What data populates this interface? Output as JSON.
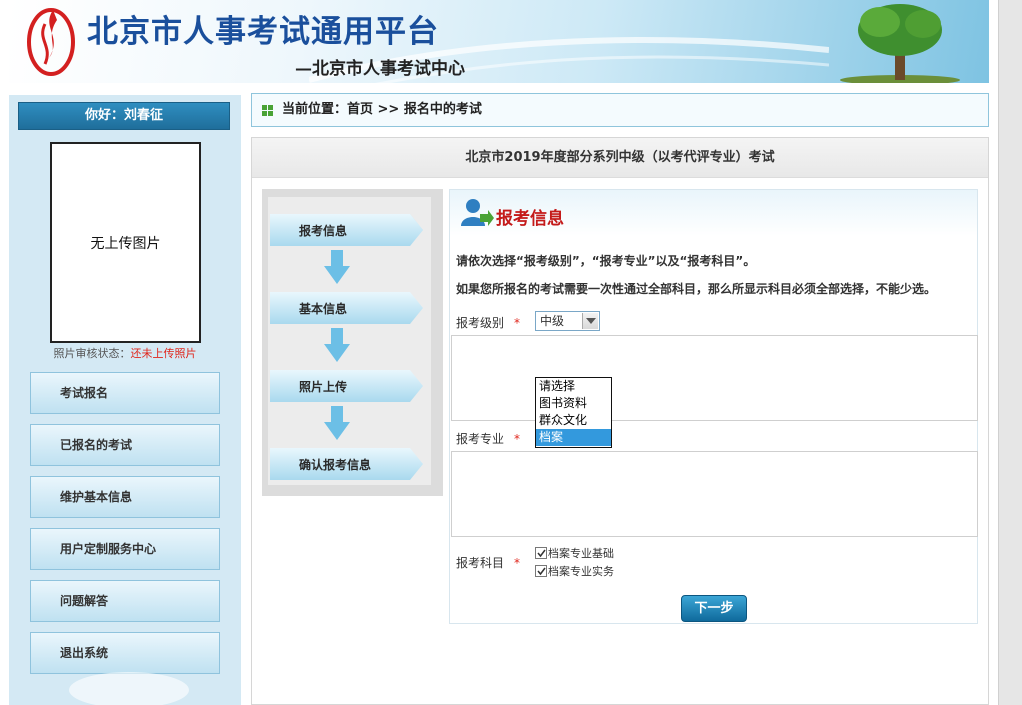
{
  "header": {
    "title": "北京市人事考试通用平台",
    "subtitle": "—北京市人事考试中心"
  },
  "user": {
    "greeting": "你好：刘春征"
  },
  "photo": {
    "placeholder": "无上传图片",
    "status_label": "照片审核状态：",
    "status_value": "还未上传照片"
  },
  "nav": {
    "items": [
      {
        "label": "考试报名"
      },
      {
        "label": "已报名的考试"
      },
      {
        "label": "维护基本信息"
      },
      {
        "label": "用户定制服务中心"
      },
      {
        "label": "问题解答"
      },
      {
        "label": "退出系统"
      }
    ]
  },
  "breadcrumb": {
    "text": "当前位置：首页 >> 报名中的考试"
  },
  "exam": {
    "title": "北京市2019年度部分系列中级（以考代评专业）考试"
  },
  "steps": [
    {
      "label": "报考信息"
    },
    {
      "label": "基本信息"
    },
    {
      "label": "照片上传"
    },
    {
      "label": "确认报考信息"
    }
  ],
  "form": {
    "heading": "报考信息",
    "note1": "请依次选择“报考级别”，“报考专业”以及“报考科目”。",
    "note2": "如果您所报名的考试需要一次性通过全部科目，那么所显示科目必须全部选择，不能少选。",
    "level_label": "报考级别",
    "level_value": "中级",
    "major_label": "报考专业",
    "subject_label": "报考科目",
    "required_mark": "*",
    "major_options": [
      "请选择",
      "图书资料",
      "群众文化",
      "档案"
    ],
    "major_selected": "档案",
    "subjects": [
      {
        "label": "档案专业基础",
        "checked": true
      },
      {
        "label": "档案专业实务",
        "checked": true
      }
    ],
    "next_label": "下一步"
  },
  "colors": {
    "accent_blue": "#1f6e9b",
    "title_blue": "#1a4f9c",
    "required_red": "#e0261c",
    "heading_red": "#c41a1a",
    "selected_option": "#3399dd"
  }
}
